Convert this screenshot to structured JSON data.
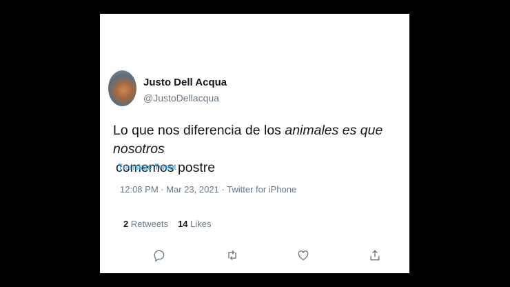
{
  "tweet": {
    "author_name": "Justo Dell Acqua",
    "handle": "@JustoDellacqua",
    "text_part1": "Lo que nos diferencia de los ",
    "text_italic": "animales es que nosotros",
    "text_part2": "comemos postre",
    "translate_label": "Translate Tweet",
    "timestamp": "12:08 PM · Mar 23, 2021 · Twitter for iPhone",
    "retweets_count": "2",
    "retweets_label": "Retweets",
    "likes_count": "14",
    "likes_label": "Likes"
  },
  "actions": [
    {
      "icon": "reply-icon"
    },
    {
      "icon": "retweet-icon"
    },
    {
      "icon": "like-icon"
    },
    {
      "icon": "share-icon"
    }
  ],
  "colors": {
    "background": "#000000",
    "card": "#ffffff",
    "text": "#14171a",
    "secondary": "#657786",
    "link": "#1da1f2"
  }
}
